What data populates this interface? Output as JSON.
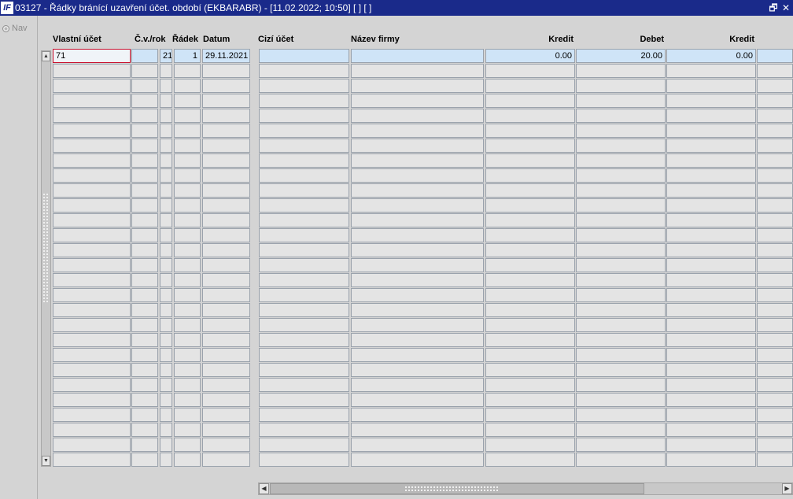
{
  "window": {
    "icon_text": "IF",
    "title": "03127 - Řádky bránící uzavření účet. období (EKBARABR) - [11.02.2022; 10:50]  [ ]  [ ]",
    "restore_glyph": "🗗",
    "close_glyph": "✕"
  },
  "nav": {
    "label": "Nav"
  },
  "columns": [
    {
      "key": "vlastni_ucet",
      "label": "Vlastní účet",
      "align": "left"
    },
    {
      "key": "cv_rok",
      "label": "Č.v./rok",
      "align": "left"
    },
    {
      "key": "radek",
      "label": "Řádek",
      "align": "left"
    },
    {
      "key": "datum",
      "label": "Datum",
      "align": "left"
    },
    {
      "key": "cizi_ucet",
      "label": "Cizí účet",
      "align": "left"
    },
    {
      "key": "nazev_firmy",
      "label": "Název firmy",
      "align": "left"
    },
    {
      "key": "kredit1",
      "label": "Kredit",
      "align": "right"
    },
    {
      "key": "debet",
      "label": "Debet",
      "align": "right"
    },
    {
      "key": "kredit2",
      "label": "Kredit",
      "align": "right"
    },
    {
      "key": "extra",
      "label": "",
      "align": "left"
    }
  ],
  "rows": [
    {
      "vlastni_ucet": "71",
      "cv_rok": "",
      "radek": "21",
      "datum": "1",
      "cizi_ucet": "29.11.2021",
      "nazev_firmy": "",
      "kredit1": "",
      "debet": "0.00",
      "kredit2": "20.00",
      "extra": "0.00"
    }
  ],
  "empty_row_count": 27,
  "scroll": {
    "up": "▲",
    "down": "▼",
    "left": "◀",
    "right": "▶"
  }
}
